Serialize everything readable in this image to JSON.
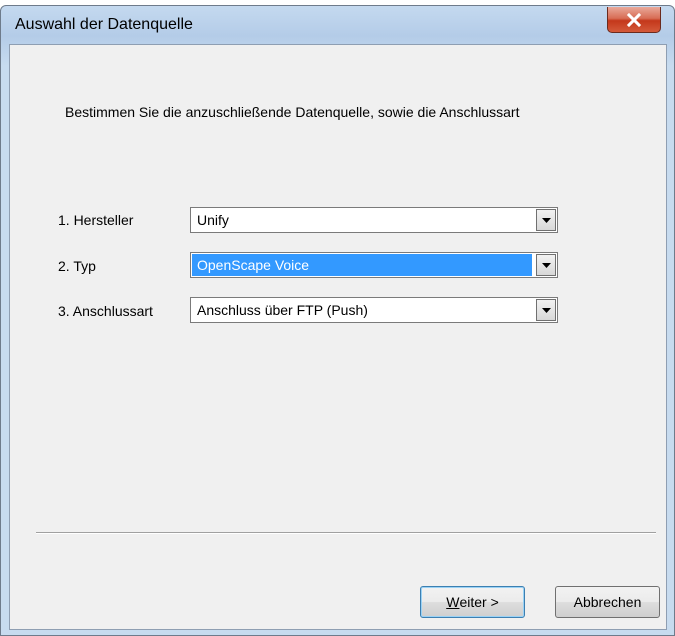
{
  "window": {
    "title": "Auswahl der Datenquelle",
    "close_icon": "close-x-icon"
  },
  "instruction": "Bestimmen Sie die anzuschließende Datenquelle, sowie die Anschlussart",
  "fields": [
    {
      "label": "1. Hersteller",
      "value": "Unify",
      "selected": false
    },
    {
      "label": "2. Typ",
      "value": "OpenScape Voice",
      "selected": true
    },
    {
      "label": "3. Anschlussart",
      "value": "Anschluss über FTP (Push)",
      "selected": false
    }
  ],
  "buttons": {
    "next_mnemonic": "W",
    "next_rest": "eiter >",
    "cancel_label": "Abbrechen"
  },
  "colors": {
    "selection": "#3399ff",
    "close_button": "#c4381b",
    "window_frame": "#b4cce8"
  }
}
